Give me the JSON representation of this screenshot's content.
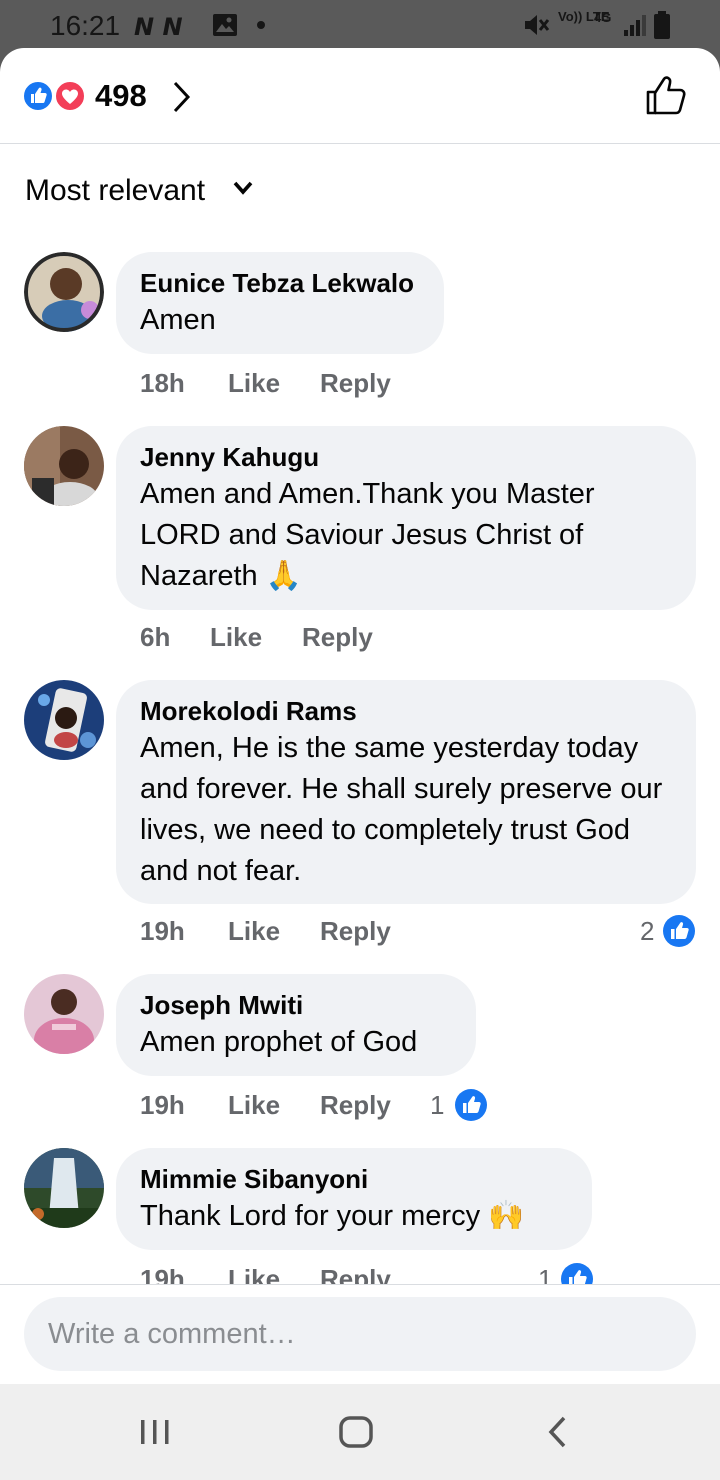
{
  "status_bar": {
    "time": "16:21",
    "signal_label": "Vo)) LTE",
    "network": "4G"
  },
  "header": {
    "reaction_count": "498",
    "reaction_icons": [
      "like-icon",
      "heart-icon"
    ]
  },
  "sort": {
    "label": "Most relevant"
  },
  "comments": [
    {
      "author": "Eunice Tebza Lekwalo",
      "text": "Amen",
      "time": "18h",
      "like": "Like",
      "reply": "Reply",
      "reactions": ""
    },
    {
      "author": "Jenny Kahugu",
      "text": "Amen and Amen.Thank you Master LORD and Saviour Jesus Christ of Nazareth 🙏",
      "time": "6h",
      "like": "Like",
      "reply": "Reply",
      "reactions": ""
    },
    {
      "author": "Morekolodi Rams",
      "text": "Amen, He is the same yesterday today and forever. He shall surely preserve our lives, we need to completely trust God and not fear.",
      "time": "19h",
      "like": "Like",
      "reply": "Reply",
      "reactions": "2"
    },
    {
      "author": "Joseph Mwiti",
      "text": "Amen prophet of God",
      "time": "19h",
      "like": "Like",
      "reply": "Reply",
      "reactions": "1"
    },
    {
      "author": "Mimmie Sibanyoni",
      "text": "Thank Lord for your mercy 🙌",
      "time": "19h",
      "like": "Like",
      "reply": "Reply",
      "reactions": "1"
    }
  ],
  "composer": {
    "placeholder": "Write a comment…"
  },
  "colors": {
    "accent": "#1877f2",
    "heart": "#f33e58",
    "bubble": "#f0f2f5",
    "meta": "#65676b"
  }
}
